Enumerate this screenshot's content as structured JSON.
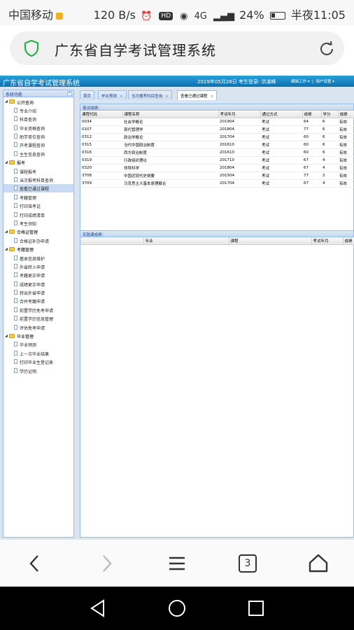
{
  "status_bar": {
    "carrier": "中国移动",
    "speed": "120 B/s",
    "network": "4G",
    "battery": "24%",
    "time": "半夜11:05"
  },
  "browser": {
    "page_title": "广东省自学考试管理系统",
    "tab_count": "3"
  },
  "app": {
    "system_title": "广东省自学考试管理系统",
    "header_info": "2019年05月28日 考生登录: 洪湛峰",
    "menu_items": [
      "编辑工作 ▾",
      "用户设置 ▾"
    ],
    "sidebar_title": "系统功能",
    "tree": [
      {
        "label": "公开查询",
        "children": [
          "专业介绍",
          "科目查询",
          "毕业资格查询",
          "助学单位查询",
          "开考课程查询",
          "主生信息查询"
        ]
      },
      {
        "label": "报考",
        "children": [
          "课程报考",
          "当次报考科目查询",
          "查看已通过课程",
          "考籍管理",
          "打印准考证",
          "打印成绩清单",
          "考生须知"
        ]
      },
      {
        "label": "合格证管理",
        "children": [
          "合格证补办申请"
        ]
      },
      {
        "label": "考籍管理",
        "children": [
          "基本信息维护",
          "外省转入申请",
          "考籍更正申请",
          "成绩更正申请",
          "转出外省申请",
          "合并考籍申请",
          "前置学历免考申请",
          "前置学历信息管理",
          "评估免考申请"
        ]
      },
      {
        "label": "毕业管理",
        "children": [
          "毕业预测",
          "上一次毕业结果",
          "打印毕业生登记表",
          "学历证明"
        ]
      }
    ],
    "tabs": [
      "首页",
      "毕业预测",
      "当次报考科目查询",
      "查看已通过课程"
    ],
    "exam_panel": {
      "title": "笔试成绩：",
      "columns": [
        "课程代码",
        "课程名称",
        "考试年月",
        "通过方式",
        "成绩",
        "学分",
        "成绩"
      ],
      "rows": [
        [
          "0034",
          "社会学概论",
          "201904",
          "考试",
          "64",
          "6",
          "有效"
        ],
        [
          "0107",
          "现代管理学",
          "201804",
          "考试",
          "77",
          "6",
          "有效"
        ],
        [
          "0312",
          "政治学概论",
          "201704",
          "考试",
          "60",
          "6",
          "有效"
        ],
        [
          "0315",
          "当代中国政治制度",
          "201610",
          "考试",
          "60",
          "6",
          "有效"
        ],
        [
          "0316",
          "西方政治制度",
          "201610",
          "考试",
          "60",
          "6",
          "有效"
        ],
        [
          "0319",
          "行政组织理论",
          "201710",
          "考试",
          "67",
          "4",
          "有效"
        ],
        [
          "0320",
          "领导科学",
          "201804",
          "考试",
          "67",
          "4",
          "有效"
        ],
        [
          "3708",
          "中国近现代史纲要",
          "201504",
          "考试",
          "77",
          "2",
          "有效"
        ],
        [
          "3709",
          "马克思主义基本原理概论",
          "201704",
          "考试",
          "67",
          "4",
          "有效"
        ]
      ]
    },
    "practice_panel": {
      "title": "实践课成绩：",
      "columns": [
        "",
        "专业",
        "课程",
        "考试年月",
        "成绩"
      ]
    }
  }
}
